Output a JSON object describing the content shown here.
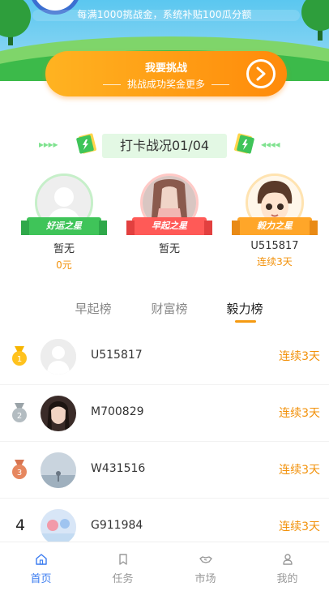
{
  "banner": {
    "notice": "每满1000挑战金，系统补贴100瓜分额",
    "challenge_title": "我要挑战",
    "challenge_subtitle": "挑战成功奖金更多"
  },
  "section": {
    "title": "打卡战况01/04"
  },
  "podium": [
    {
      "badge": "好运之星",
      "name": "暂无",
      "value": "0元",
      "ring_color": "#c6efc9",
      "ribbon_color": "#3fc459"
    },
    {
      "badge": "早起之星",
      "name": "暂无",
      "value": "",
      "ring_color": "#ffc9c6",
      "ribbon_color": "#ff5a57"
    },
    {
      "badge": "毅力之星",
      "name": "U515817",
      "value": "连续3天",
      "ring_color": "#ffe3b0",
      "ribbon_color": "#ffa629"
    }
  ],
  "tabs": [
    {
      "label": "早起榜"
    },
    {
      "label": "财富榜"
    },
    {
      "label": "毅力榜"
    }
  ],
  "ranking": [
    {
      "rank": "1",
      "name": "U515817",
      "value": "连续3天"
    },
    {
      "rank": "2",
      "name": "M700829",
      "value": "连续3天"
    },
    {
      "rank": "3",
      "name": "W431516",
      "value": "连续3天"
    },
    {
      "rank": "4",
      "name": "G911984",
      "value": "连续3天"
    }
  ],
  "nav": [
    {
      "label": "首页",
      "icon": "home-icon"
    },
    {
      "label": "任务",
      "icon": "bookmark-icon"
    },
    {
      "label": "市场",
      "icon": "handshake-icon"
    },
    {
      "label": "我的",
      "icon": "user-icon"
    }
  ],
  "colors": {
    "accent_orange": "#f2910a",
    "active_blue": "#3b7cf0",
    "grass_green": "#3cba4a",
    "sky_blue": "#5bc7f0"
  }
}
